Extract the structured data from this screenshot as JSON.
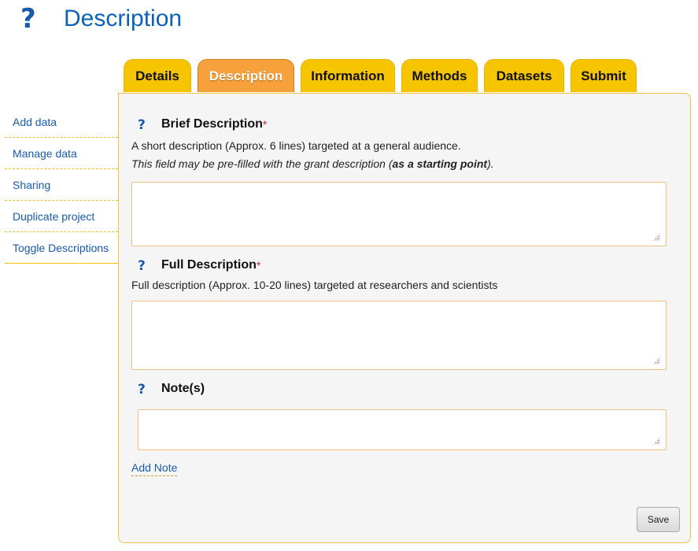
{
  "page": {
    "title": "Description",
    "help_glyph": "?",
    "help_icon": "question-mark-icon"
  },
  "tabs": [
    {
      "label": "Details",
      "active": false
    },
    {
      "label": "Description",
      "active": true
    },
    {
      "label": "Information",
      "active": false
    },
    {
      "label": "Methods",
      "active": false
    },
    {
      "label": "Datasets",
      "active": false
    },
    {
      "label": "Submit",
      "active": false
    }
  ],
  "sidebar": {
    "items": [
      {
        "label": "Add data"
      },
      {
        "label": "Manage data"
      },
      {
        "label": "Sharing"
      },
      {
        "label": "Duplicate project"
      },
      {
        "label": "Toggle Descriptions"
      }
    ]
  },
  "form": {
    "required_marker": "*",
    "brief": {
      "label": "Brief Description",
      "help": "A short description (Approx. 6 lines) targeted at a general audience.",
      "note_before": "This field may be pre-filled with the grant description (",
      "note_bold": "as a starting point",
      "note_after": ").",
      "value": ""
    },
    "full": {
      "label": "Full Description",
      "help": "Full description (Approx. 10-20 lines) targeted at researchers and scientists",
      "value": ""
    },
    "notes": {
      "label": "Note(s)",
      "value": ""
    },
    "add_note_label": "Add Note",
    "save_label": "Save"
  },
  "colors": {
    "tab": "#f7c400",
    "tab_active": "#f7a13c",
    "link": "#1a5aa8",
    "title": "#0d62b5",
    "required": "#d61f1f",
    "panel_border": "#f0c24a"
  }
}
